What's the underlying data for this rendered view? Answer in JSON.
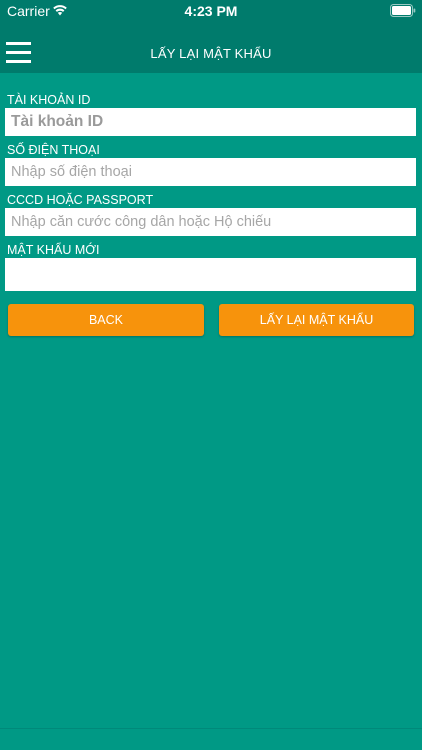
{
  "status_bar": {
    "carrier": "Carrier",
    "time": "4:23 PM",
    "wifi_icon": "wifi-icon",
    "battery_icon": "battery-icon"
  },
  "nav": {
    "title": "LẤY LẠI MẬT KHẨU",
    "menu_icon": "hamburger-menu-icon"
  },
  "form": {
    "account_id": {
      "label": "TÀI KHOẢN ID",
      "placeholder": "Tài khoản ID",
      "value": ""
    },
    "phone": {
      "label": "SỐ ĐIỆN THOẠI",
      "placeholder": "Nhập số điện thoại",
      "value": ""
    },
    "id_card": {
      "label": "CCCD HOẶC PASSPORT",
      "placeholder": "Nhập căn cước công dân hoặc Hộ chiếu",
      "value": ""
    },
    "new_password": {
      "label": "MẬT KHẨU MỚI",
      "placeholder": "",
      "value": ""
    }
  },
  "buttons": {
    "back": "BACK",
    "recover": "LẤY LẠI MẬT KHẨU"
  },
  "colors": {
    "background": "#009985",
    "header": "#007b6c",
    "button": "#f7930c",
    "text_on_dark": "#ffffff"
  }
}
